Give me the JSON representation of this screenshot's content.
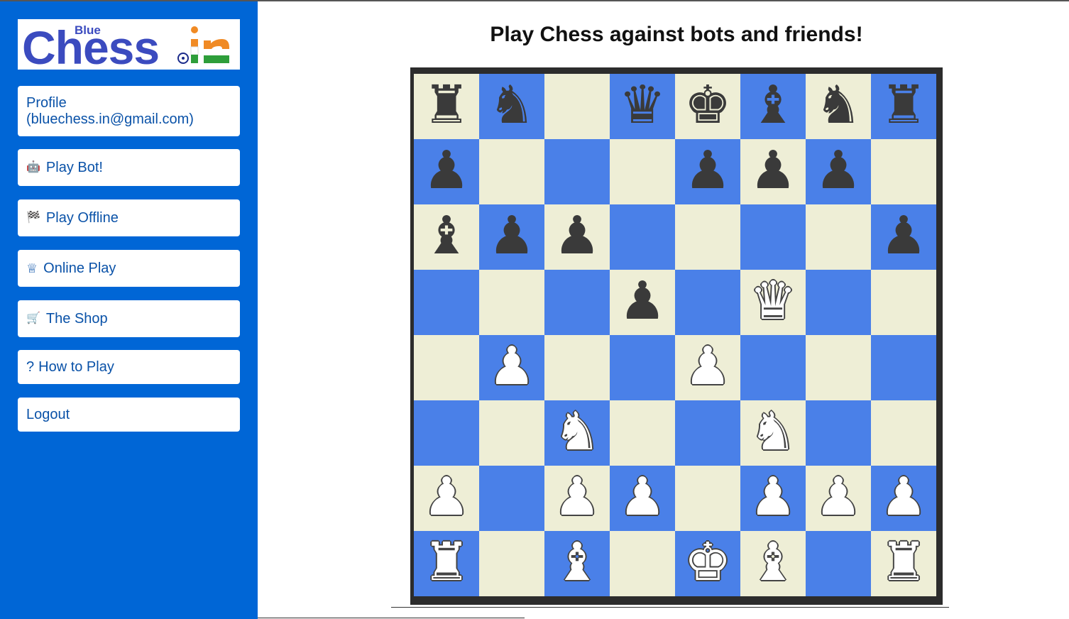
{
  "logo": {
    "small_text": "Blue",
    "main_text": "Chess",
    "suffix_text": ".in"
  },
  "sidebar": {
    "profile": {
      "label": "Profile",
      "email": "(bluechess.in@gmail.com)"
    },
    "items": [
      {
        "icon": "🤖",
        "icon_name": "robot-icon",
        "label": "Play Bot!"
      },
      {
        "icon": "🏁",
        "icon_name": "checkered-flag-icon",
        "label": "Play Offline"
      },
      {
        "icon": "♕",
        "icon_name": "crown-icon",
        "label": "Online Play"
      },
      {
        "icon": "🛒",
        "icon_name": "shopping-cart-icon",
        "label": "The Shop"
      },
      {
        "icon": "?",
        "icon_name": "question-icon",
        "label": "How to Play"
      },
      {
        "icon": "",
        "icon_name": "",
        "label": "Logout"
      }
    ]
  },
  "main": {
    "title": "Play Chess against bots and friends!"
  },
  "board": {
    "rows": [
      [
        "br",
        "bn",
        "",
        "bq",
        "bk",
        "bb",
        "bn",
        "br"
      ],
      [
        "bp",
        "",
        "",
        "",
        "bp",
        "bp",
        "bp",
        ""
      ],
      [
        "bb",
        "bp",
        "bp",
        "",
        "",
        "",
        "",
        "bp"
      ],
      [
        "",
        "",
        "",
        "bp",
        "",
        "wq",
        "",
        ""
      ],
      [
        "",
        "wp",
        "",
        "",
        "wp",
        "",
        "",
        ""
      ],
      [
        "",
        "",
        "wn",
        "",
        "",
        "wn",
        "",
        ""
      ],
      [
        "wp",
        "",
        "wp",
        "wp",
        "",
        "wp",
        "wp",
        "wp"
      ],
      [
        "wr",
        "",
        "wb",
        "",
        "wk",
        "wb",
        "",
        "wr"
      ]
    ],
    "light_color": "#eeeed6",
    "dark_color": "#4a80e8"
  },
  "colors": {
    "sidebar": "#0066d6",
    "nav_text": "#0a52a8"
  }
}
